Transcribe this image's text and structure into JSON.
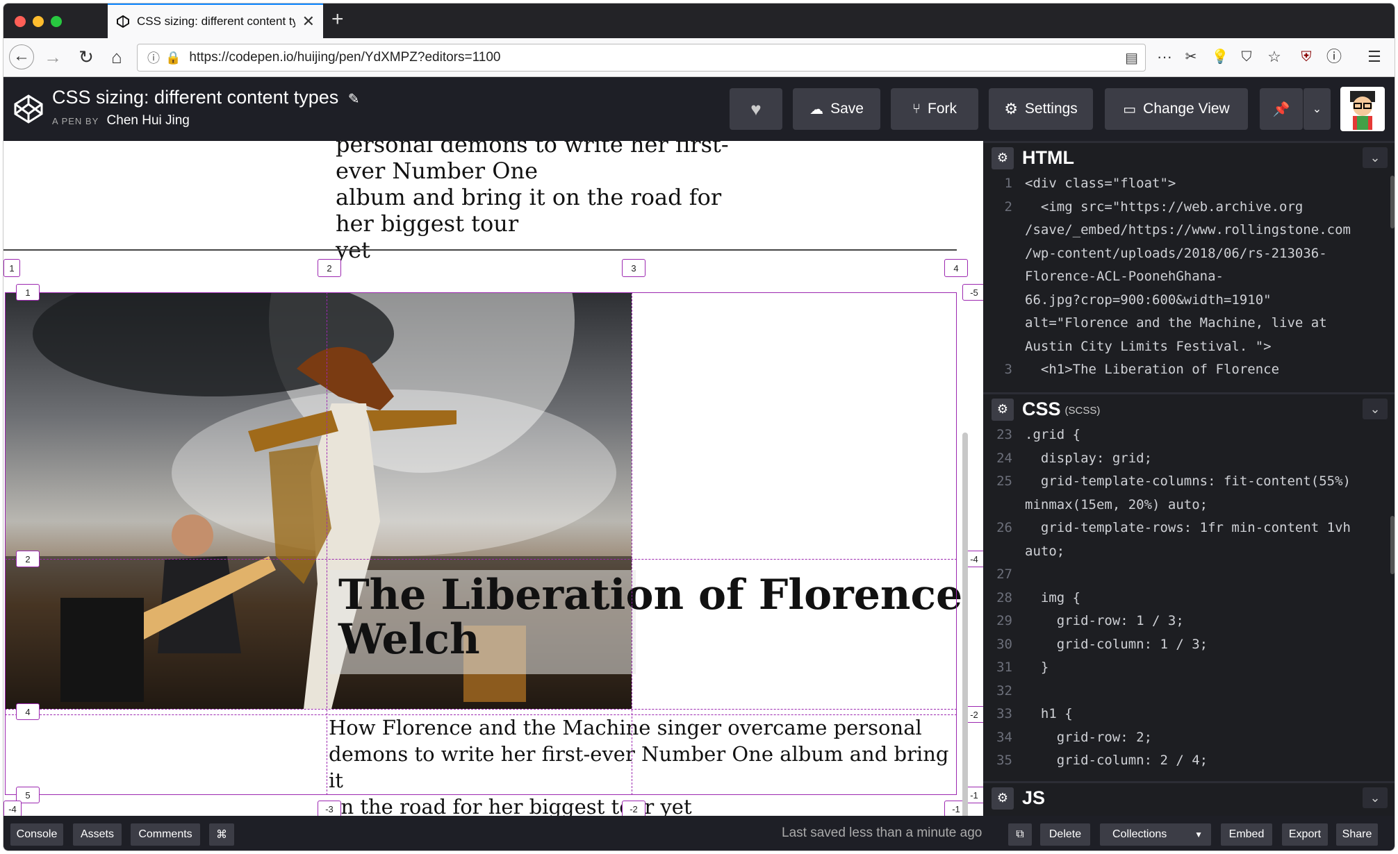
{
  "browser": {
    "tab_title": "CSS sizing: different content ty",
    "url": "https://codepen.io/huijing/pen/YdXMPZ?editors=1100",
    "close_glyph": "✕",
    "new_tab_glyph": "+"
  },
  "pen": {
    "title": "CSS sizing: different content types",
    "by_label": "A PEN BY",
    "author": "Chen Hui Jing"
  },
  "header_buttons": {
    "save": "Save",
    "fork": "Fork",
    "settings": "Settings",
    "change_view": "Change View"
  },
  "preview": {
    "prev_text_line1": "personal demons to write her first-ever Number One",
    "prev_text_line2": "album and bring it on the road for her biggest tour",
    "prev_text_line3": "yet",
    "headline_line1": "The Liberation of Florence",
    "headline_line2": "Welch",
    "subtext_line1": "How Florence and the Machine singer overcame personal",
    "subtext_line2": "demons to write her first-ever Number One album and bring it",
    "subtext_line3": "on the road for her biggest tour yet"
  },
  "grid_badges": {
    "top": [
      "1",
      "2",
      "3",
      "4"
    ],
    "left": [
      "1",
      "2",
      "4",
      "5"
    ],
    "right": [
      "-5",
      "-4",
      "-2",
      "-1"
    ],
    "bottom": [
      "-4",
      "-3",
      "-2",
      "-1"
    ]
  },
  "editors": {
    "html_label": "HTML",
    "css_label": "CSS",
    "css_sub": "(SCSS)",
    "js_label": "JS",
    "html_lines": [
      {
        "n": "1",
        "t": "<div class=\"float\">"
      },
      {
        "n": "2",
        "t": "  <img src=\"https://web.archive.org"
      },
      {
        "n": "",
        "t": "/save/_embed/https://www.rollingstone.com"
      },
      {
        "n": "",
        "t": "/wp-content/uploads/2018/06/rs-213036-"
      },
      {
        "n": "",
        "t": "Florence-ACL-PoonehGhana-"
      },
      {
        "n": "",
        "t": "66.jpg?crop=900:600&width=1910\""
      },
      {
        "n": "",
        "t": "alt=\"Florence and the Machine, live at"
      },
      {
        "n": "",
        "t": "Austin City Limits Festival. \">"
      },
      {
        "n": "3",
        "t": "  <h1>The Liberation of Florence"
      }
    ],
    "css_lines": [
      {
        "n": "23",
        "t": ".grid {"
      },
      {
        "n": "24",
        "t": "  display: grid;"
      },
      {
        "n": "25",
        "t": "  grid-template-columns: fit-content(55%)"
      },
      {
        "n": "",
        "t": "minmax(15em, 20%) auto;"
      },
      {
        "n": "26",
        "t": "  grid-template-rows: 1fr min-content 1vh"
      },
      {
        "n": "",
        "t": "auto;"
      },
      {
        "n": "27",
        "t": ""
      },
      {
        "n": "28",
        "t": "  img {"
      },
      {
        "n": "29",
        "t": "    grid-row: 1 / 3;"
      },
      {
        "n": "30",
        "t": "    grid-column: 1 / 3;"
      },
      {
        "n": "31",
        "t": "  }"
      },
      {
        "n": "32",
        "t": ""
      },
      {
        "n": "33",
        "t": "  h1 {"
      },
      {
        "n": "34",
        "t": "    grid-row: 2;"
      },
      {
        "n": "35",
        "t": "    grid-column: 2 / 4;"
      }
    ]
  },
  "footer": {
    "console": "Console",
    "assets": "Assets",
    "comments": "Comments",
    "shortcut": "⌘",
    "saved_status": "Last saved less than a minute ago",
    "delete": "Delete",
    "collections": "Collections",
    "embed": "Embed",
    "export": "Export",
    "share": "Share"
  },
  "colors": {
    "grid_overlay": "#9c27b0",
    "header_bg": "#1e1f26",
    "editor_bg": "#1d1e22"
  }
}
